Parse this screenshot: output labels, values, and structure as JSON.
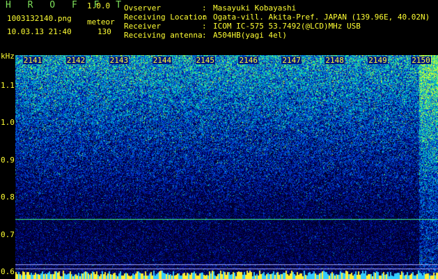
{
  "header": {
    "app_title": "H R O F F T",
    "version": "1.0.0",
    "file_name": "1003132140.png",
    "kind": "meteor",
    "datetime": "10.03.13 21:40",
    "count": "130"
  },
  "info": [
    {
      "key": "Ovserver",
      "sep": ":",
      "value": "Masayuki Kobayashi"
    },
    {
      "key": "Receiving Location",
      "sep": ":",
      "value": "Ogata-vill. Akita-Pref. JAPAN (139.96E, 40.02N)"
    },
    {
      "key": "Receiver",
      "sep": ":",
      "value": "ICOM IC-575 53.7492(@LCD)MHz USB"
    },
    {
      "key": "Receiving antenna",
      "sep": ":",
      "value": "A504HB(yagi 4el)"
    }
  ],
  "spectrogram": {
    "y_unit": "kHz",
    "y_ticks": [
      "1.1",
      "1.0",
      "0.9",
      "0.8",
      "0.7",
      "0.6"
    ],
    "y_tick_values": [
      1.1,
      1.0,
      0.9,
      0.8,
      0.7,
      0.6
    ],
    "y_range": [
      0.58,
      1.18
    ],
    "x_ticks": [
      "2141",
      "2142",
      "2143",
      "2144",
      "2145",
      "2146",
      "2147",
      "2148",
      "2149",
      "2150"
    ],
    "x_range": [
      2140.6,
      2150.4
    ],
    "marker_lines_khz": [
      0.74,
      0.62,
      0.608
    ],
    "colors": {
      "label": "#ffff33",
      "marker_main": "#44ff88",
      "marker_minor": "#aaaaff"
    }
  }
}
